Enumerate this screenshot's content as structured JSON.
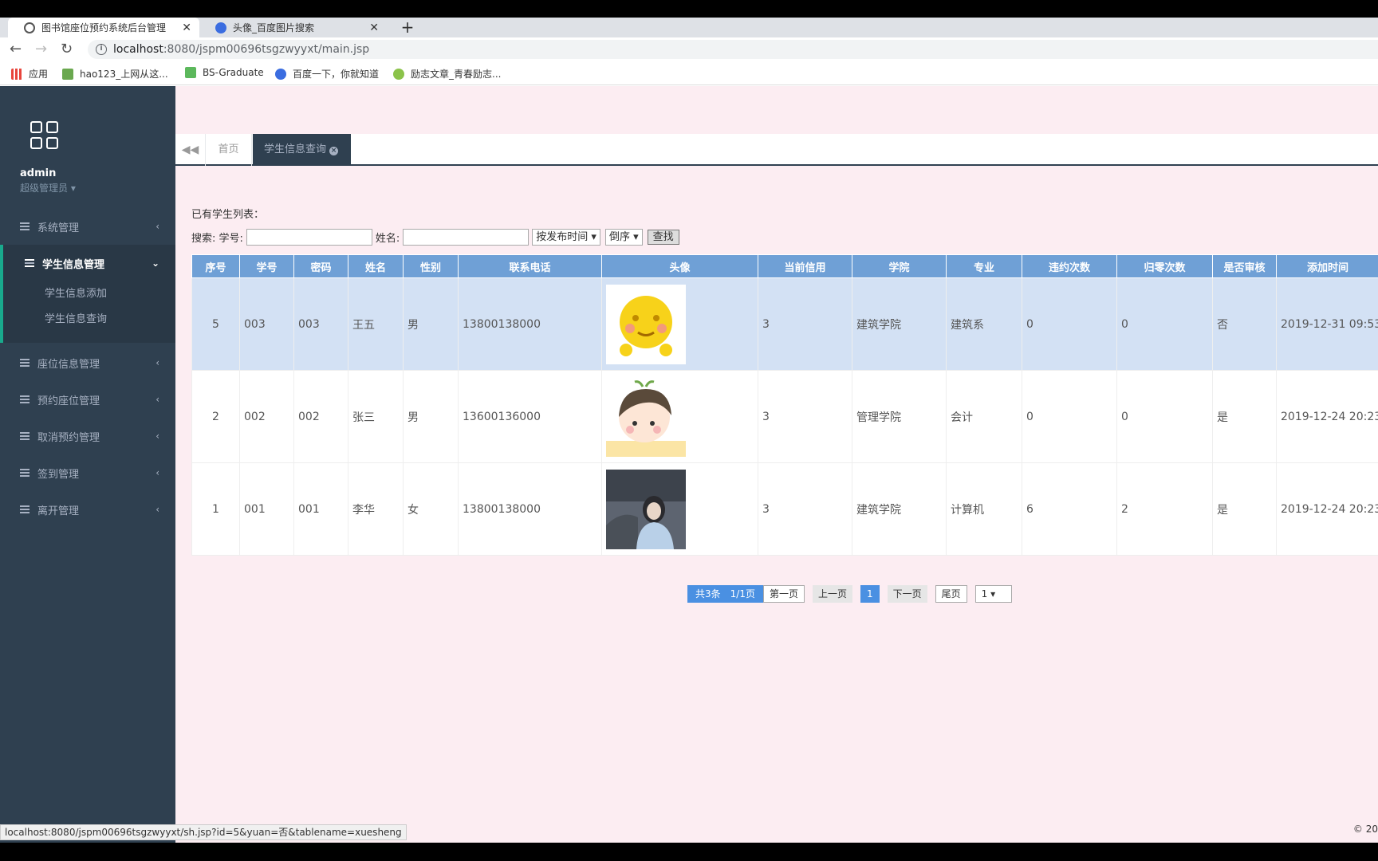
{
  "browser": {
    "tabs": [
      {
        "title": "图书馆座位预约系统后台管理",
        "close": "✕"
      },
      {
        "title": "头像_百度图片搜索",
        "close": "✕"
      }
    ],
    "new_tab": "+",
    "url_host": "localhost",
    "url_path": ":8080/jspm00696tsgzwyyxt/main.jsp",
    "bookmarks": [
      "应用",
      "hao123_上网从这...",
      "BS-Graduate",
      "百度一下，你就知道",
      "励志文章_青春励志..."
    ],
    "status_url": "localhost:8080/jspm00696tsgzwyyxt/sh.jsp?id=5&yuan=否&tablename=xuesheng"
  },
  "sidebar": {
    "username": "admin",
    "role": "超级管理员",
    "menu": [
      {
        "label": "系统管理"
      },
      {
        "label": "学生信息管理"
      },
      {
        "label": "座位信息管理"
      },
      {
        "label": "预约座位管理"
      },
      {
        "label": "取消预约管理"
      },
      {
        "label": "签到管理"
      },
      {
        "label": "离开管理"
      }
    ],
    "submenu": [
      "学生信息添加",
      "学生信息查询"
    ]
  },
  "tabs": {
    "home": "首页",
    "current": "学生信息查询"
  },
  "content": {
    "list_title": "已有学生列表：",
    "search_label": "搜索: 学号:",
    "name_label": "姓名:",
    "sort_field": "按发布时间 ▾",
    "sort_order": "倒序 ▾",
    "search_button": "查找"
  },
  "table": {
    "headers": [
      "序号",
      "学号",
      "密码",
      "姓名",
      "性别",
      "联系电话",
      "头像",
      "当前信用",
      "学院",
      "专业",
      "违约次数",
      "归零次数",
      "是否审核",
      "添加时间"
    ],
    "rows": [
      {
        "no": "5",
        "sid": "003",
        "pwd": "003",
        "name": "王五",
        "gender": "男",
        "phone": "13800138000",
        "avatar": "emoji-face",
        "credit": "3",
        "college": "建筑学院",
        "major": "建筑系",
        "violations": "0",
        "resets": "0",
        "audited": "否",
        "added": "2019-12-31 09:53"
      },
      {
        "no": "2",
        "sid": "002",
        "pwd": "002",
        "name": "张三",
        "gender": "男",
        "phone": "13600136000",
        "avatar": "cartoon-boy",
        "credit": "3",
        "college": "管理学院",
        "major": "会计",
        "violations": "0",
        "resets": "0",
        "audited": "是",
        "added": "2019-12-24 20:23"
      },
      {
        "no": "1",
        "sid": "001",
        "pwd": "001",
        "name": "李华",
        "gender": "女",
        "phone": "13800138000",
        "avatar": "photo-girl",
        "credit": "3",
        "college": "建筑学院",
        "major": "计算机",
        "violations": "6",
        "resets": "2",
        "audited": "是",
        "added": "2019-12-24 20:23"
      }
    ]
  },
  "pager": {
    "info": "共3条　1/1页",
    "first": "第一页",
    "prev": "上一页",
    "page": "1",
    "next": "下一页",
    "last": "尾页",
    "select": "1 ▾"
  },
  "footer": {
    "copyright": "© 20"
  },
  "colors": {
    "sidebar": "#2f4050",
    "header_blue": "#6fa0d6",
    "highlight_row": "#d3e1f4",
    "main_bg": "#fcedf2",
    "accent": "#19aa8d"
  }
}
